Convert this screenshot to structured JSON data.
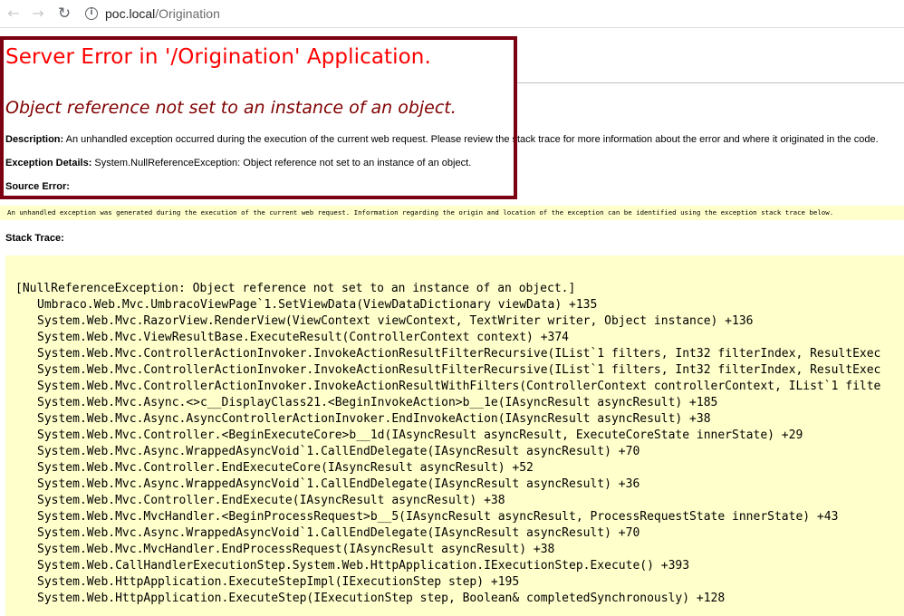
{
  "browser": {
    "back_icon": "arrow-left-icon",
    "forward_icon": "arrow-right-icon",
    "reload_icon": "reload-icon",
    "info_icon": "info-icon",
    "url_host": "poc.local",
    "url_path": "/Origination"
  },
  "page": {
    "title": "Server Error in '/Origination' Application.",
    "error_message": "Object reference not set to an instance of an object.",
    "description_label": "Description:",
    "description_text": " An unhandled exception occurred during the execution of the current web request. Please review the stack trace for more information about the error and where it originated in the code.",
    "exception_label": "Exception Details:",
    "exception_text": " System.NullReferenceException: Object reference not set to an instance of an object.",
    "source_error_label": "Source Error:",
    "source_error_text": "An unhandled exception was generated during the execution of the current web request. Information regarding the origin and location of the exception can be identified using the exception stack trace below.",
    "stack_trace_label": "Stack Trace:",
    "stack_first_line": "[NullReferenceException: Object reference not set to an instance of an object.]",
    "stack_lines": [
      "Umbraco.Web.Mvc.UmbracoViewPage`1.SetViewData(ViewDataDictionary viewData) +135",
      "System.Web.Mvc.RazorView.RenderView(ViewContext viewContext, TextWriter writer, Object instance) +136",
      "System.Web.Mvc.ViewResultBase.ExecuteResult(ControllerContext context) +374",
      "System.Web.Mvc.ControllerActionInvoker.InvokeActionResultFilterRecursive(IList`1 filters, Int32 filterIndex, ResultExec",
      "System.Web.Mvc.ControllerActionInvoker.InvokeActionResultFilterRecursive(IList`1 filters, Int32 filterIndex, ResultExec",
      "System.Web.Mvc.ControllerActionInvoker.InvokeActionResultWithFilters(ControllerContext controllerContext, IList`1 filte",
      "System.Web.Mvc.Async.<>c__DisplayClass21.<BeginInvokeAction>b__1e(IAsyncResult asyncResult) +185",
      "System.Web.Mvc.Async.AsyncControllerActionInvoker.EndInvokeAction(IAsyncResult asyncResult) +38",
      "System.Web.Mvc.Controller.<BeginExecuteCore>b__1d(IAsyncResult asyncResult, ExecuteCoreState innerState) +29",
      "System.Web.Mvc.Async.WrappedAsyncVoid`1.CallEndDelegate(IAsyncResult asyncResult) +70",
      "System.Web.Mvc.Controller.EndExecuteCore(IAsyncResult asyncResult) +52",
      "System.Web.Mvc.Async.WrappedAsyncVoid`1.CallEndDelegate(IAsyncResult asyncResult) +36",
      "System.Web.Mvc.Controller.EndExecute(IAsyncResult asyncResult) +38",
      "System.Web.Mvc.MvcHandler.<BeginProcessRequest>b__5(IAsyncResult asyncResult, ProcessRequestState innerState) +43",
      "System.Web.Mvc.Async.WrappedAsyncVoid`1.CallEndDelegate(IAsyncResult asyncResult) +70",
      "System.Web.Mvc.MvcHandler.EndProcessRequest(IAsyncResult asyncResult) +38",
      "System.Web.CallHandlerExecutionStep.System.Web.HttpApplication.IExecutionStep.Execute() +393",
      "System.Web.HttpApplication.ExecuteStepImpl(IExecutionStep step) +195",
      "System.Web.HttpApplication.ExecuteStep(IExecutionStep step, Boolean& completedSynchronously) +128"
    ]
  },
  "colors": {
    "title": "#ff0000",
    "message": "#800000",
    "highlight_border": "#7b0011",
    "trace_background": "#ffffcc"
  }
}
